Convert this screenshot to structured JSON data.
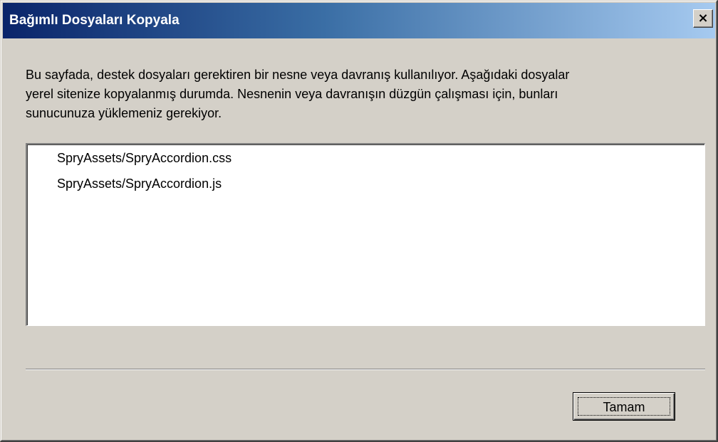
{
  "window": {
    "title": "Bağımlı Dosyaları Kopyala",
    "close_label": "×"
  },
  "message": {
    "lines": [
      "Bu sayfada, destek dosyaları gerektiren bir nesne veya davranış kullanılıyor. Aşağıdaki dosyalar",
      "yerel sitenize kopyalanmış durumda. Nesnenin veya davranışın düzgün çalışması için, bunları",
      "sunucunuza yüklemeniz gerekiyor."
    ]
  },
  "files": [
    "SpryAssets/SpryAccordion.css",
    "SpryAssets/SpryAccordion.js"
  ],
  "buttons": {
    "ok_label": "Tamam"
  },
  "colors": {
    "titlebar_start": "#0a246a",
    "titlebar_end": "#a6caf0",
    "face": "#d4d0c8"
  }
}
